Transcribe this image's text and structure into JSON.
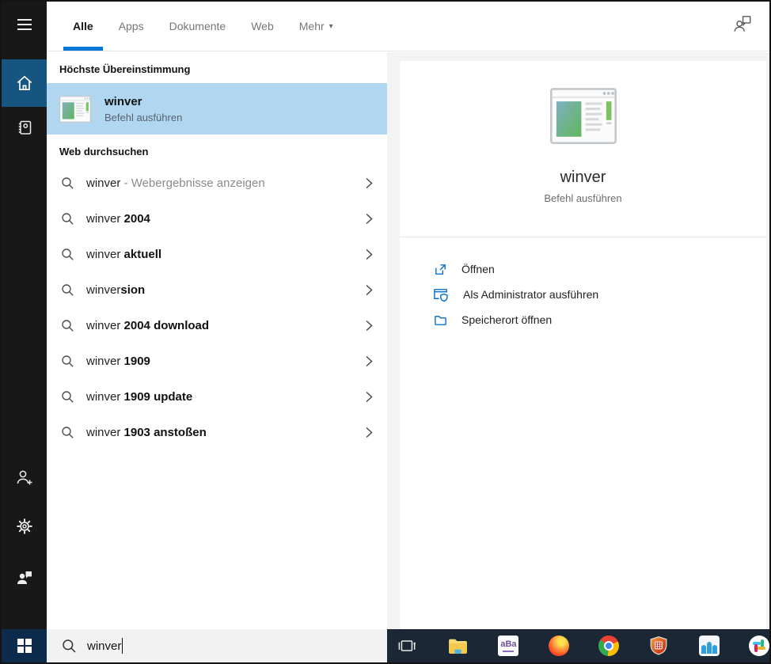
{
  "accent": "#0078d7",
  "header": {
    "tabs": [
      {
        "label": "Alle",
        "active": true
      },
      {
        "label": "Apps",
        "active": false
      },
      {
        "label": "Dokumente",
        "active": false
      },
      {
        "label": "Web",
        "active": false
      },
      {
        "label": "Mehr",
        "active": false,
        "dropdown_arrow": "▾"
      }
    ]
  },
  "best_match": {
    "section_title": "Höchste Übereinstimmung",
    "title": "winver",
    "subtitle": "Befehl ausführen",
    "selected": true,
    "selection_color": "#b0d6f0"
  },
  "web_search": {
    "section_title": "Web durchsuchen",
    "items": [
      {
        "typed": "winver",
        "rest": " - Webergebnisse anzeigen",
        "muted": true
      },
      {
        "typed": "winver",
        "rest": " 2004"
      },
      {
        "typed": "winver",
        "rest": " aktuell"
      },
      {
        "typed": "winver",
        "rest": "sion"
      },
      {
        "typed": "winver",
        "rest": " 2004 download"
      },
      {
        "typed": "winver",
        "rest": " 1909"
      },
      {
        "typed": "winver",
        "rest": " 1909 update"
      },
      {
        "typed": "winver",
        "rest": " 1903 anstoßen"
      }
    ]
  },
  "preview": {
    "title": "winver",
    "subtitle": "Befehl ausführen",
    "actions": [
      {
        "label": "Öffnen",
        "icon": "open-icon"
      },
      {
        "label": "Als Administrator ausführen",
        "icon": "admin-shield-icon"
      },
      {
        "label": "Speicherort öffnen",
        "icon": "file-location-icon"
      }
    ]
  },
  "search_box": {
    "value": "winver",
    "placeholder": ""
  },
  "sidebar_icons": [
    "menu",
    "home",
    "notebook",
    "add-account",
    "settings",
    "feedback",
    "windows-start"
  ],
  "taskbar": {
    "color": "#1c2735",
    "icons": [
      "task-view",
      "file-explorer",
      "purple-app",
      "firefox",
      "chrome",
      "password-safe-shield",
      "people-app",
      "slack"
    ]
  }
}
